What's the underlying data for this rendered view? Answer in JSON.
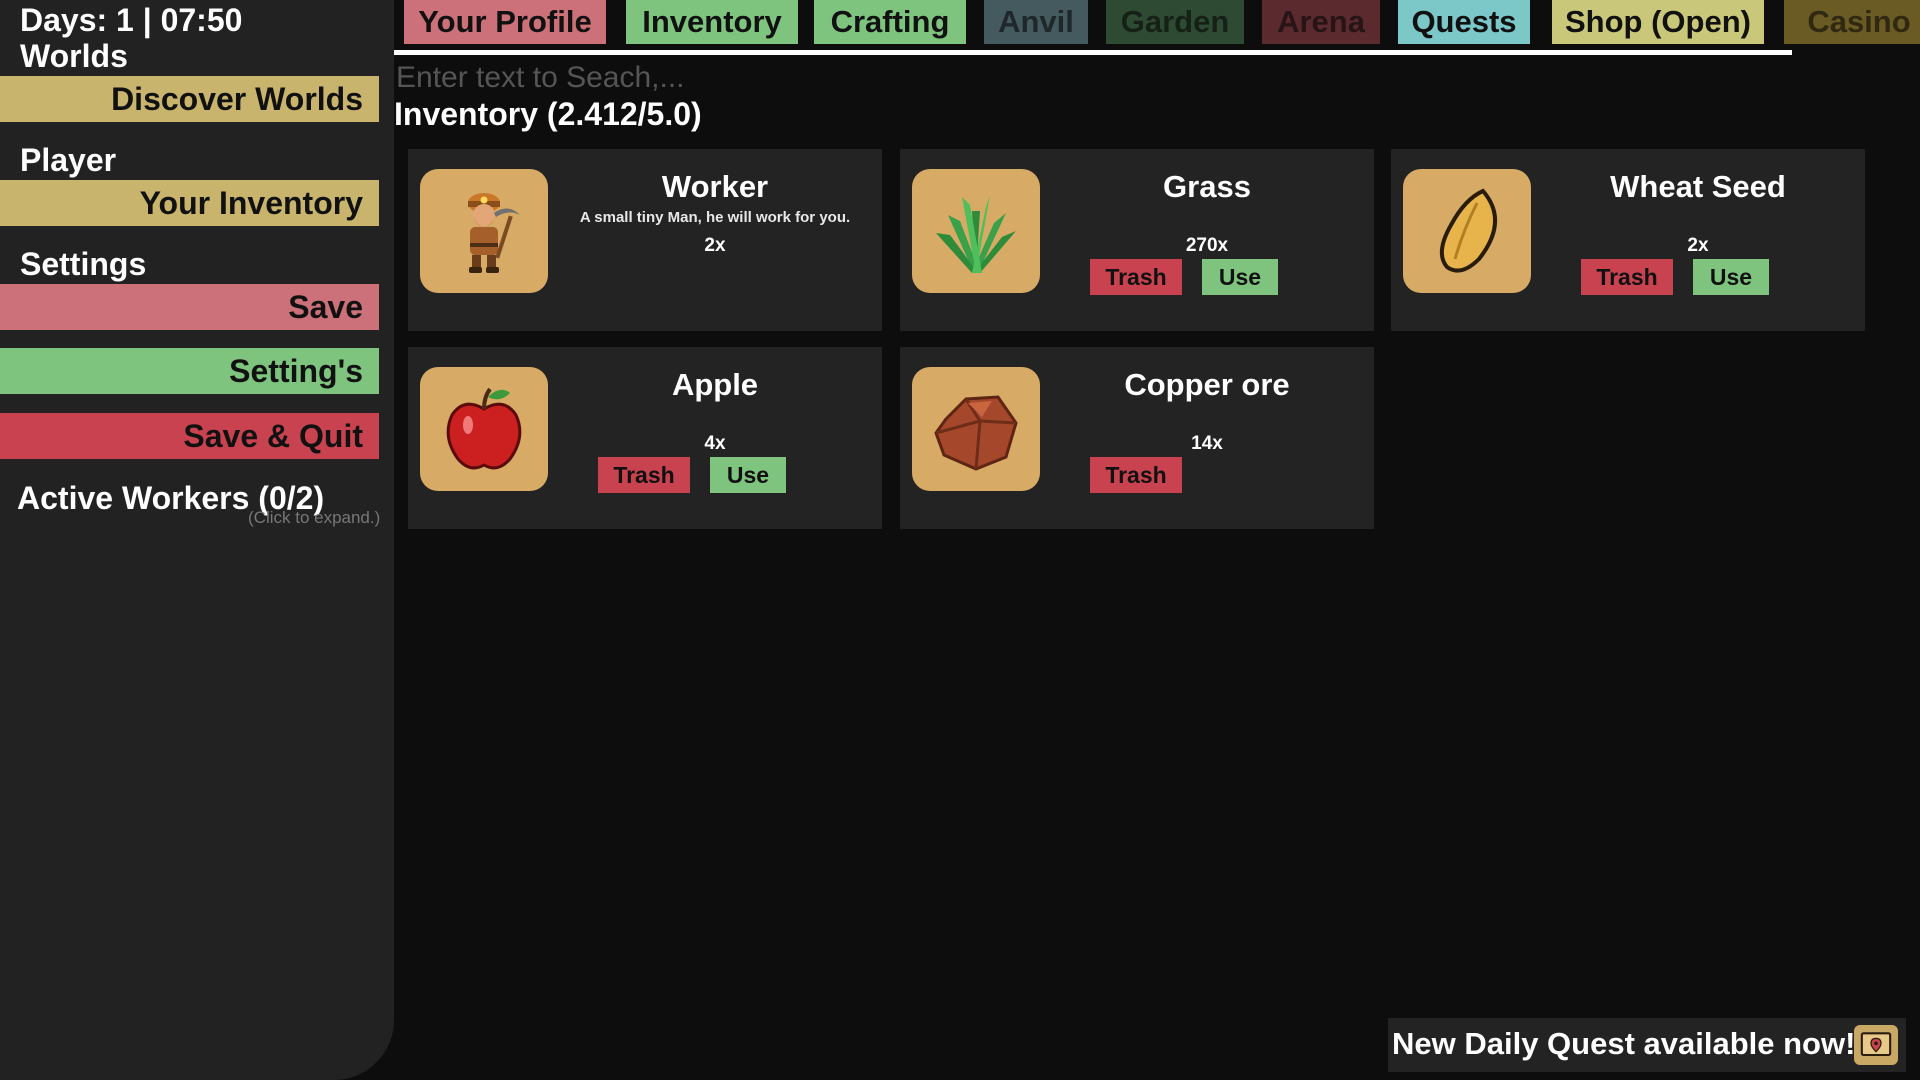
{
  "sidebar": {
    "day_clock": "Days: 1 | 07:50",
    "worlds_title": "Worlds",
    "discover_worlds": "Discover Worlds",
    "player_title": "Player",
    "your_inventory": "Your Inventory",
    "settings_title": "Settings",
    "save": "Save",
    "settings_btn": "Setting's",
    "save_quit": "Save & Quit",
    "active_workers": "Active Workers (0/2)",
    "expand_hint": "(Click to expand.)"
  },
  "tabs": [
    {
      "label": "Your Profile",
      "color": "#cc707a"
    },
    {
      "label": "Inventory",
      "color": "#7fc47e"
    },
    {
      "label": "Crafting",
      "color": "#7fc47e"
    },
    {
      "label": "Anvil",
      "color": "#445a5e"
    },
    {
      "label": "Garden",
      "color": "#2f4a33"
    },
    {
      "label": "Arena",
      "color": "#5a2a2f"
    },
    {
      "label": "Quests",
      "color": "#7cc7c8"
    },
    {
      "label": "Shop (Open)",
      "color": "#c9c87a"
    },
    {
      "label": "Casino",
      "color": "#6a5a24"
    }
  ],
  "search": {
    "placeholder": "Enter text to Seach,..."
  },
  "inventory": {
    "title": "Inventory (2.412/5.0)",
    "items": [
      {
        "name": "Worker",
        "desc": "A small tiny Man, he will work for you.",
        "count": "2x",
        "icon": "worker-icon"
      },
      {
        "name": "Grass",
        "count": "270x",
        "trash": "Trash",
        "use": "Use",
        "icon": "grass-icon"
      },
      {
        "name": "Wheat Seed",
        "count": "2x",
        "trash": "Trash",
        "use": "Use",
        "icon": "wheat-seed-icon"
      },
      {
        "name": "Apple",
        "count": "4x",
        "trash": "Trash",
        "use": "Use",
        "icon": "apple-icon"
      },
      {
        "name": "Copper ore",
        "count": "14x",
        "trash": "Trash",
        "icon": "copper-ore-icon"
      }
    ]
  },
  "notification": {
    "text": "New Daily Quest available now!",
    "icon": "map-icon"
  }
}
